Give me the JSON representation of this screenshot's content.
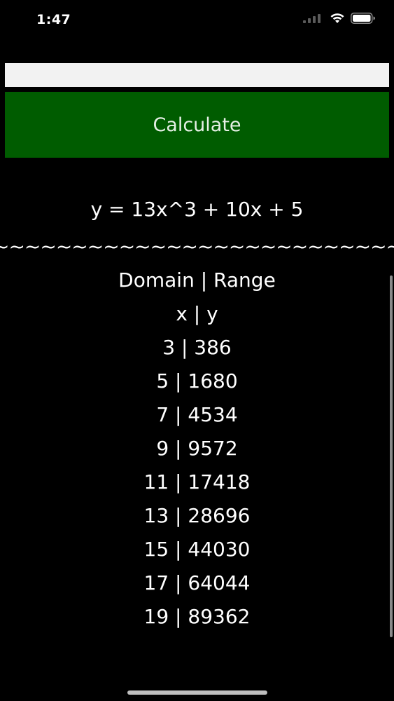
{
  "status_bar": {
    "time": "1:47",
    "icons": [
      "cellular-signal-icon",
      "wifi-icon",
      "battery-icon"
    ]
  },
  "input": {
    "value": "",
    "placeholder": ""
  },
  "calculate_button": {
    "label": "Calculate",
    "color": "#005c00"
  },
  "equation": "y = 13x^3 + 10x + 5",
  "separator": "~~~~~~~~~~~~~~~~~~~~~~~~~~~~~~~~",
  "results": {
    "header": "Domain | Range",
    "subheader": "x | y",
    "rows": [
      "3 | 386",
      "5 | 1680",
      "7 | 4534",
      "9 | 9572",
      "11 | 17418",
      "13 | 28696",
      "15 | 44030",
      "17 | 64044",
      "19 | 89362"
    ]
  }
}
